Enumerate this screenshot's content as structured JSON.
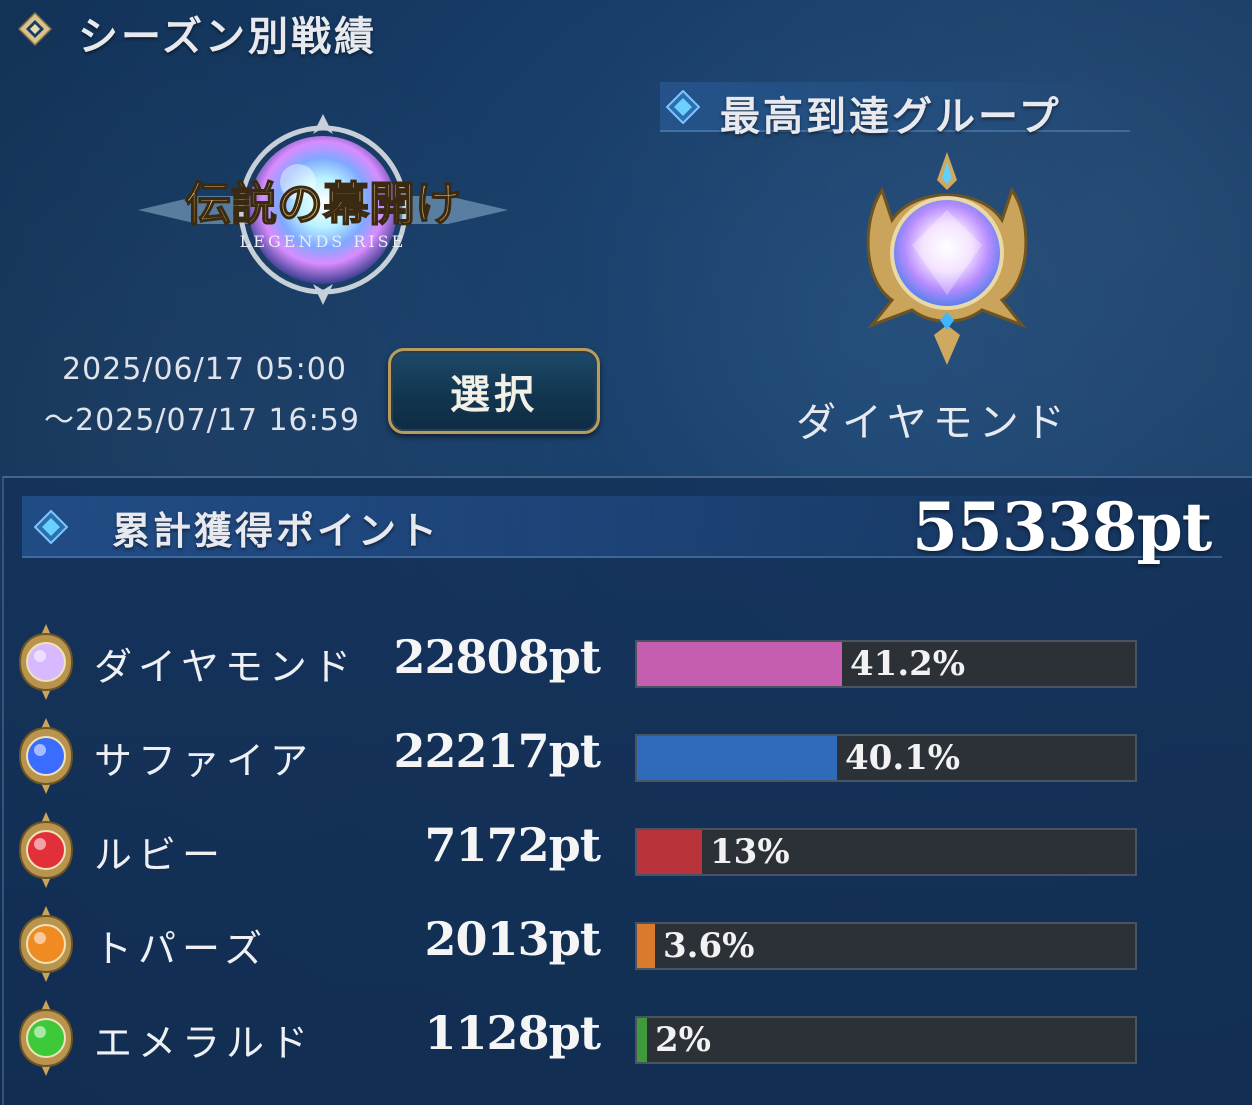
{
  "season": {
    "title": "シーズン別戦績",
    "logo_text": "伝説の幕開け",
    "logo_subtext": "LEGENDS RISE",
    "date_start": "2025/06/17 05:00",
    "date_end": "～2025/07/17 16:59",
    "select_label": "選択"
  },
  "group": {
    "title": "最高到達グループ",
    "name": "ダイヤモンド",
    "icon": "diamond-rank-emblem-icon"
  },
  "points": {
    "title": "累計獲得ポイント",
    "total": "55338pt",
    "rows": [
      {
        "name": "ダイヤモンド",
        "value": "22808pt",
        "percent_label": "41.2%",
        "percent": 41.2,
        "color": "#c55db0",
        "icon": "diamond-gem-icon",
        "gem_color": "#d8b8ff"
      },
      {
        "name": "サファイア",
        "value": "22217pt",
        "percent_label": "40.1%",
        "percent": 40.1,
        "color": "#2f6bb8",
        "icon": "sapphire-gem-icon",
        "gem_color": "#3a6cff"
      },
      {
        "name": "ルビー",
        "value": "7172pt",
        "percent_label": "13%",
        "percent": 13,
        "color": "#b8333a",
        "icon": "ruby-gem-icon",
        "gem_color": "#e2303a"
      },
      {
        "name": "トパーズ",
        "value": "2013pt",
        "percent_label": "3.6%",
        "percent": 3.6,
        "color": "#d97a2c",
        "icon": "topaz-gem-icon",
        "gem_color": "#f08a22"
      },
      {
        "name": "エメラルド",
        "value": "1128pt",
        "percent_label": "2%",
        "percent": 2,
        "color": "#3e9a3a",
        "icon": "emerald-gem-icon",
        "gem_color": "#3ec93a"
      }
    ]
  }
}
